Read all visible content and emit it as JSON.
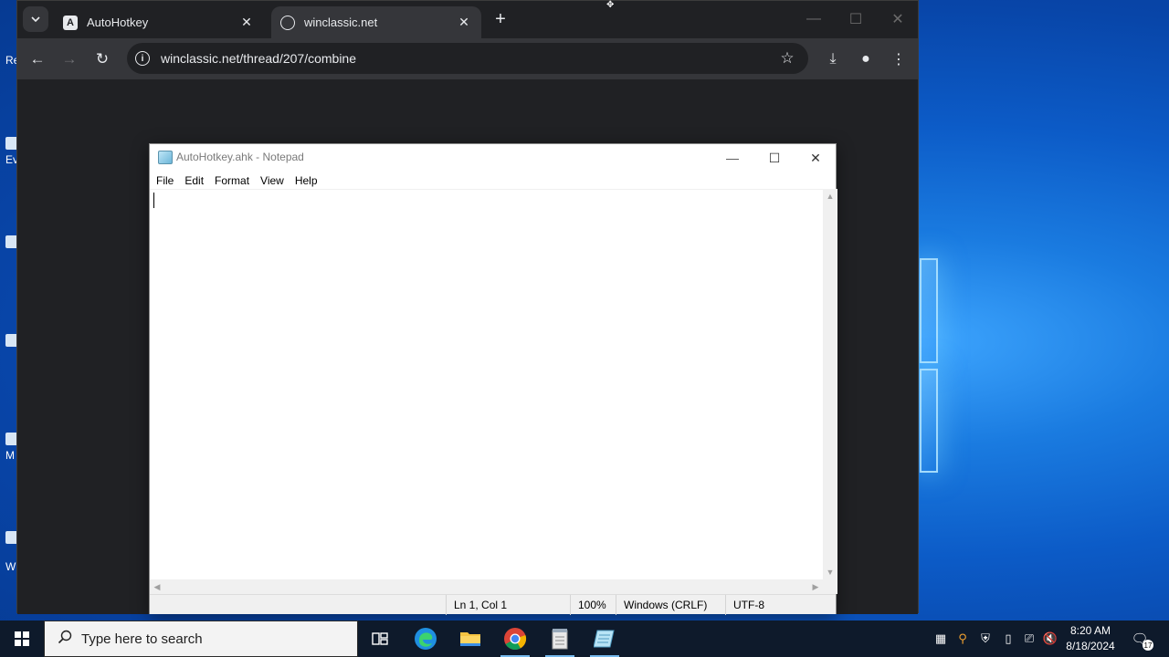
{
  "browser": {
    "tabs": [
      {
        "title": "AutoHotkey",
        "favicon": "letter-a-icon",
        "favicon_letter": "A",
        "active": false
      },
      {
        "title": "winclassic.net",
        "favicon": "globe-icon",
        "active": true
      }
    ],
    "tab_search_icon": "chevron-down-icon",
    "new_tab_icon": "+",
    "url": "winclassic.net/thread/207/combine",
    "icons": {
      "back": "←",
      "forward": "→",
      "reload": "↻",
      "info": "i",
      "star": "☆",
      "download": "⤓",
      "profile": "●",
      "menu": "⋮",
      "close": "✕",
      "minimize": "—",
      "maximize": "☐"
    }
  },
  "notepad": {
    "title": "AutoHotkey.ahk - Notepad",
    "menu": [
      "File",
      "Edit",
      "Format",
      "View",
      "Help"
    ],
    "content": "",
    "status": {
      "position": "Ln 1, Col 1",
      "zoom": "100%",
      "line_endings": "Windows (CRLF)",
      "encoding": "UTF-8"
    },
    "controls": {
      "minimize": "—",
      "maximize": "☐",
      "close": "✕"
    }
  },
  "taskbar": {
    "search_placeholder": "Type here to search",
    "search_icon": "⚲",
    "apps": [
      "task-view",
      "edge",
      "file-explorer",
      "chrome",
      "notepad-app",
      "notepad"
    ],
    "tray": {
      "time": "8:20 AM",
      "date": "8/18/2024",
      "notification_count": "17"
    }
  },
  "desktop": {
    "icon_labels": [
      "Re",
      "Ev",
      "M",
      "W"
    ]
  }
}
